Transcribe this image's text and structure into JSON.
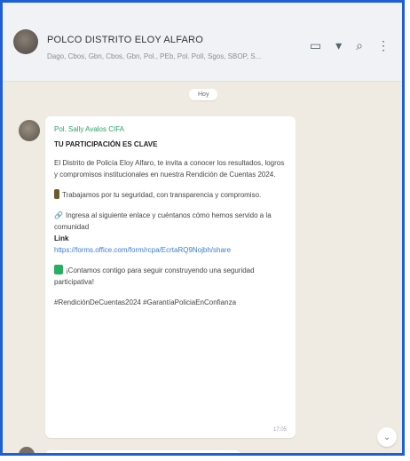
{
  "chat": {
    "title": "POLCO DISTRITO ELOY ALFARO",
    "participants": "Dago, Cbos, Gbn, Cbos, Gbn, Pol., PEb, Pol. PolI, Sgos, SBOP, S..."
  },
  "header_icons": [
    "video-call-icon",
    "chevron-down-icon",
    "search-icon",
    "menu-icon"
  ],
  "date_label": "Hoy",
  "message": {
    "sender": "Pol. Sally Avalos CIFA",
    "title": "TU PARTICIPACIÓN ES CLAVE",
    "p1": "El Distrito de Policía Eloy Alfaro, te invita a conocer los resultados, logros y compromisos institucionales en nuestra Rendición de Cuentas 2024.",
    "p2": "Trabajamos por tu seguridad, con transparencia y compromiso.",
    "p3": "Ingresa al siguiente enlace y cuéntanos cómo hemos servido a la comunidad",
    "link_label": "Link",
    "link_url": "https://forms.office.com/form/rcpa/EcrtaRQ9Nojbh/share",
    "p4": "¡Contamos contigo para seguir construyendo una seguridad participativa!",
    "hashtags": "#RendiciónDeCuentas2024 #GarantíaPoliciaEnConfianza",
    "time": "17:05"
  },
  "colors": {
    "frame_border": "#1f5fd6",
    "chat_background": "#efeae2",
    "header_background": "#f0f2f5",
    "sender_color": "#2aa56a",
    "link_color": "#3a7bd5"
  }
}
